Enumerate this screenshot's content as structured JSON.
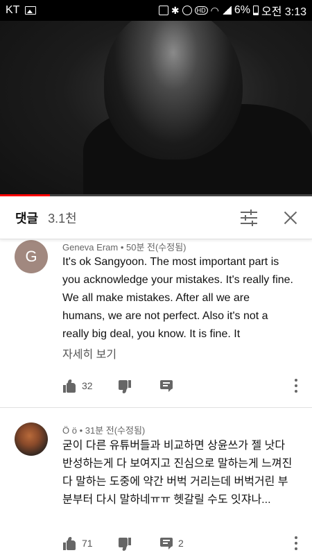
{
  "status_bar": {
    "carrier": "KT",
    "battery": "6%",
    "time": "오전 3:13",
    "hd_label": "HD"
  },
  "video": {
    "progress_fraction": 0.16
  },
  "comments_header": {
    "title": "댓글",
    "count": "3.1천"
  },
  "comments": [
    {
      "avatar_letter": "G",
      "meta": "Geneva Eram • 50분 전(수정됨)",
      "text": "It's ok Sangyoon. The most important part is you acknowledge your mistakes. It's really fine. We all make mistakes. After all we are humans, we are not perfect. Also it's not a really big deal, you know. It is fine. It",
      "more": "자세히 보기",
      "likes": "32",
      "replies": ""
    },
    {
      "avatar_letter": "",
      "meta": "Ö ö • 31분 전(수정됨)",
      "text": "굳이 다른 유튜버들과 비교하면 상윤쓰가 젤 낫다 반성하는게 다 보여지고 진심으로 말하는게 느껴진다 말하는 도중에 약간 버벅 거리는데 버벅거린 부분부터 다시 말하네ㅠㅠ 헷갈릴 수도 잇쟈나...",
      "more": "",
      "likes": "71",
      "replies": "2"
    }
  ],
  "colors": {
    "progress_red": "#ff0000",
    "avatar_g": "#a1887f",
    "icon_gray": "#666666"
  },
  "icons": [
    "image-icon",
    "battery-icon",
    "bluetooth-icon",
    "alarm-icon",
    "wifi-icon",
    "signal-icon",
    "sort-icon",
    "close-icon",
    "thumb-up-icon",
    "thumb-down-icon",
    "reply-icon",
    "more-vert-icon"
  ]
}
